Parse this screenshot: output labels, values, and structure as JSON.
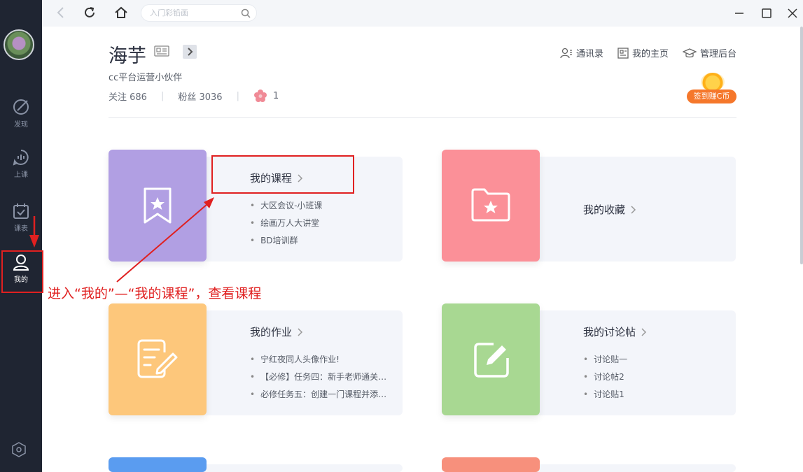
{
  "sidebar": {
    "items": [
      {
        "label": "发现",
        "icon": "compass-icon"
      },
      {
        "label": "上课",
        "icon": "live-class-icon"
      },
      {
        "label": "课表",
        "icon": "calendar-check-icon"
      },
      {
        "label": "我的",
        "icon": "user-icon",
        "active": true
      }
    ],
    "settings_icon": "hexagon-settings-icon"
  },
  "topbar": {
    "search_placeholder": "入门彩铅画"
  },
  "profile": {
    "name": "海芋",
    "subtitle": "cc平台运营小伙伴",
    "following_label": "关注 686",
    "fans_label": "粉丝 3036",
    "flowers": "1"
  },
  "header_links": [
    {
      "label": "通讯录",
      "icon": "contacts-icon"
    },
    {
      "label": "我的主页",
      "icon": "homepage-icon"
    },
    {
      "label": "管理后台",
      "icon": "graduation-cap-icon"
    }
  ],
  "signin_label": "签到赚C币",
  "cards": {
    "courses": {
      "title": "我的课程",
      "items": [
        "大区会议-小班课",
        "绘画万人大讲堂",
        "BD培训群"
      ]
    },
    "favorites": {
      "title": "我的收藏"
    },
    "homework": {
      "title": "我的作业",
      "items": [
        "宁红夜同人头像作业!",
        "【必修】任务四：新手老师通关小...",
        "必修任务五：创建一门课程并添加..."
      ]
    },
    "discussions": {
      "title": "我的讨论帖",
      "items": [
        "讨论贴一",
        "讨论帖2",
        "讨论贴1"
      ]
    }
  },
  "annotation": "进入“我的”—“我的课程”，查看课程",
  "colors": {
    "sidebar_bg": "#1f2532",
    "courses_tile": "#b19fe3",
    "favorites_tile": "#fb9098",
    "homework_tile": "#fdc77b",
    "discussions_tile": "#a8d892",
    "blue_tile": "#5a9cf0",
    "salmon_tile": "#f7907c",
    "annotation_red": "#e02020",
    "signin_orange": "#f5772b"
  }
}
